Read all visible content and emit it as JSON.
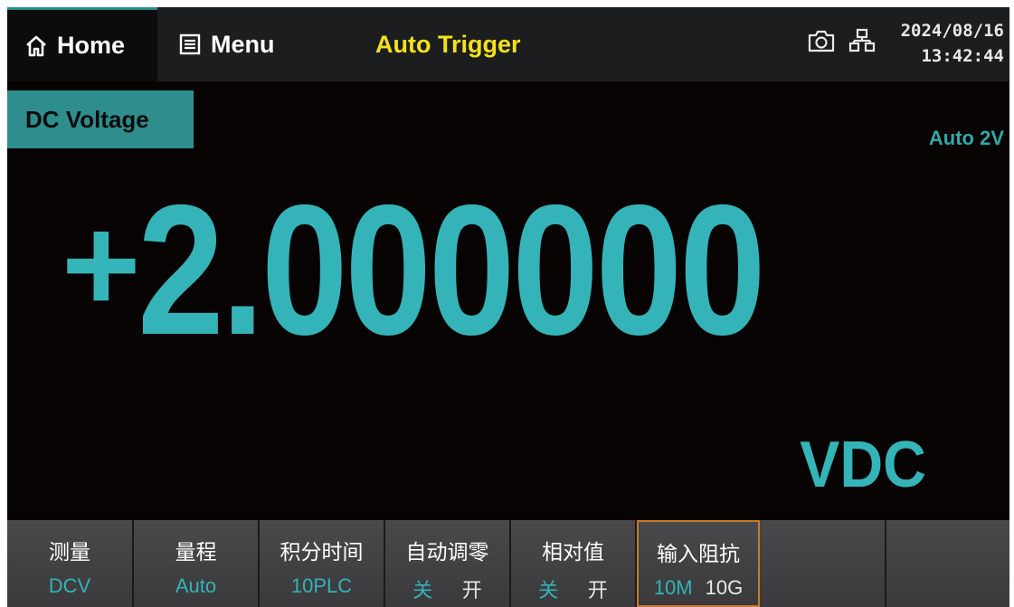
{
  "topbar": {
    "home_label": "Home",
    "menu_label": "Menu",
    "trigger_mode": "Auto Trigger",
    "date": "2024/08/16",
    "time": "13:42:44",
    "icons": [
      "home-icon",
      "menu-icon",
      "camera-icon",
      "network-icon"
    ]
  },
  "measurement": {
    "function": "DC Voltage",
    "range": "Auto 2V",
    "sign": "+",
    "value": "2.000000",
    "unit": "VDC"
  },
  "softkeys": [
    {
      "title": "测量",
      "value": "DCV"
    },
    {
      "title": "量程",
      "value": "Auto"
    },
    {
      "title": "积分时间",
      "value": "10PLC"
    },
    {
      "title": "自动调零",
      "options": [
        "关",
        "开"
      ],
      "selected": "关"
    },
    {
      "title": "相对值",
      "options": [
        "关",
        "开"
      ],
      "selected": "关"
    },
    {
      "title": "输入阻抗",
      "options": [
        "10M",
        "10G"
      ],
      "selected": "10M"
    },
    {
      "title": "",
      "value": ""
    },
    {
      "title": "",
      "value": ""
    }
  ],
  "colors": {
    "accent": "#34b4b8",
    "trigger": "#f5e11a",
    "badge": "#2e8e8d",
    "active_border": "#c87a2a",
    "background": "#070303"
  }
}
